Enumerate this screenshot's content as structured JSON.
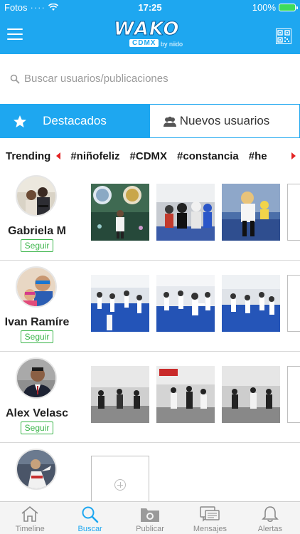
{
  "status_bar": {
    "carrier": "Fotos",
    "time": "17:25",
    "battery": "100%"
  },
  "header": {
    "logo_main": "WAKO",
    "logo_sub": "CDMX",
    "logo_by": "by niido"
  },
  "search": {
    "placeholder": "Buscar usuarios/publicaciones"
  },
  "tabs": [
    {
      "label": "Destacados",
      "active": true,
      "icon": "star-icon"
    },
    {
      "label": "Nuevos usuarios",
      "active": false,
      "icon": "users-icon"
    }
  ],
  "trending": {
    "label": "Trending",
    "tags": [
      "#niñofeliz",
      "#CDMX",
      "#constancia",
      "#he"
    ]
  },
  "users": [
    {
      "name": "Gabriela M",
      "follow_label": "Seguir"
    },
    {
      "name": "Ivan Ramíre",
      "follow_label": "Seguir"
    },
    {
      "name": "Alex Velasc",
      "follow_label": "Seguir"
    },
    {
      "name": "",
      "follow_label": ""
    }
  ],
  "bottom_nav": [
    {
      "label": "Timeline",
      "icon": "home-icon",
      "active": false
    },
    {
      "label": "Buscar",
      "icon": "search-icon",
      "active": true
    },
    {
      "label": "Publicar",
      "icon": "camera-folder-icon",
      "active": false
    },
    {
      "label": "Mensajes",
      "icon": "chat-icon",
      "active": false
    },
    {
      "label": "Alertas",
      "icon": "bell-icon",
      "active": false
    }
  ],
  "colors": {
    "brand": "#1ea7f0",
    "follow": "#3bb54a",
    "trend_arrow": "#e32222"
  }
}
